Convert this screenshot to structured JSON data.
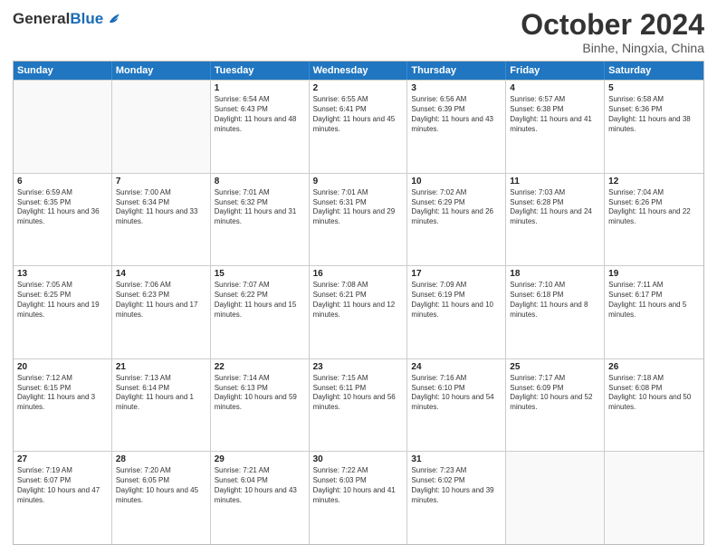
{
  "header": {
    "logo_general": "General",
    "logo_blue": "Blue",
    "month_title": "October 2024",
    "subtitle": "Binhe, Ningxia, China"
  },
  "days_of_week": [
    "Sunday",
    "Monday",
    "Tuesday",
    "Wednesday",
    "Thursday",
    "Friday",
    "Saturday"
  ],
  "weeks": [
    [
      {
        "day": "",
        "info": ""
      },
      {
        "day": "",
        "info": ""
      },
      {
        "day": "1",
        "info": "Sunrise: 6:54 AM\nSunset: 6:43 PM\nDaylight: 11 hours and 48 minutes."
      },
      {
        "day": "2",
        "info": "Sunrise: 6:55 AM\nSunset: 6:41 PM\nDaylight: 11 hours and 45 minutes."
      },
      {
        "day": "3",
        "info": "Sunrise: 6:56 AM\nSunset: 6:39 PM\nDaylight: 11 hours and 43 minutes."
      },
      {
        "day": "4",
        "info": "Sunrise: 6:57 AM\nSunset: 6:38 PM\nDaylight: 11 hours and 41 minutes."
      },
      {
        "day": "5",
        "info": "Sunrise: 6:58 AM\nSunset: 6:36 PM\nDaylight: 11 hours and 38 minutes."
      }
    ],
    [
      {
        "day": "6",
        "info": "Sunrise: 6:59 AM\nSunset: 6:35 PM\nDaylight: 11 hours and 36 minutes."
      },
      {
        "day": "7",
        "info": "Sunrise: 7:00 AM\nSunset: 6:34 PM\nDaylight: 11 hours and 33 minutes."
      },
      {
        "day": "8",
        "info": "Sunrise: 7:01 AM\nSunset: 6:32 PM\nDaylight: 11 hours and 31 minutes."
      },
      {
        "day": "9",
        "info": "Sunrise: 7:01 AM\nSunset: 6:31 PM\nDaylight: 11 hours and 29 minutes."
      },
      {
        "day": "10",
        "info": "Sunrise: 7:02 AM\nSunset: 6:29 PM\nDaylight: 11 hours and 26 minutes."
      },
      {
        "day": "11",
        "info": "Sunrise: 7:03 AM\nSunset: 6:28 PM\nDaylight: 11 hours and 24 minutes."
      },
      {
        "day": "12",
        "info": "Sunrise: 7:04 AM\nSunset: 6:26 PM\nDaylight: 11 hours and 22 minutes."
      }
    ],
    [
      {
        "day": "13",
        "info": "Sunrise: 7:05 AM\nSunset: 6:25 PM\nDaylight: 11 hours and 19 minutes."
      },
      {
        "day": "14",
        "info": "Sunrise: 7:06 AM\nSunset: 6:23 PM\nDaylight: 11 hours and 17 minutes."
      },
      {
        "day": "15",
        "info": "Sunrise: 7:07 AM\nSunset: 6:22 PM\nDaylight: 11 hours and 15 minutes."
      },
      {
        "day": "16",
        "info": "Sunrise: 7:08 AM\nSunset: 6:21 PM\nDaylight: 11 hours and 12 minutes."
      },
      {
        "day": "17",
        "info": "Sunrise: 7:09 AM\nSunset: 6:19 PM\nDaylight: 11 hours and 10 minutes."
      },
      {
        "day": "18",
        "info": "Sunrise: 7:10 AM\nSunset: 6:18 PM\nDaylight: 11 hours and 8 minutes."
      },
      {
        "day": "19",
        "info": "Sunrise: 7:11 AM\nSunset: 6:17 PM\nDaylight: 11 hours and 5 minutes."
      }
    ],
    [
      {
        "day": "20",
        "info": "Sunrise: 7:12 AM\nSunset: 6:15 PM\nDaylight: 11 hours and 3 minutes."
      },
      {
        "day": "21",
        "info": "Sunrise: 7:13 AM\nSunset: 6:14 PM\nDaylight: 11 hours and 1 minute."
      },
      {
        "day": "22",
        "info": "Sunrise: 7:14 AM\nSunset: 6:13 PM\nDaylight: 10 hours and 59 minutes."
      },
      {
        "day": "23",
        "info": "Sunrise: 7:15 AM\nSunset: 6:11 PM\nDaylight: 10 hours and 56 minutes."
      },
      {
        "day": "24",
        "info": "Sunrise: 7:16 AM\nSunset: 6:10 PM\nDaylight: 10 hours and 54 minutes."
      },
      {
        "day": "25",
        "info": "Sunrise: 7:17 AM\nSunset: 6:09 PM\nDaylight: 10 hours and 52 minutes."
      },
      {
        "day": "26",
        "info": "Sunrise: 7:18 AM\nSunset: 6:08 PM\nDaylight: 10 hours and 50 minutes."
      }
    ],
    [
      {
        "day": "27",
        "info": "Sunrise: 7:19 AM\nSunset: 6:07 PM\nDaylight: 10 hours and 47 minutes."
      },
      {
        "day": "28",
        "info": "Sunrise: 7:20 AM\nSunset: 6:05 PM\nDaylight: 10 hours and 45 minutes."
      },
      {
        "day": "29",
        "info": "Sunrise: 7:21 AM\nSunset: 6:04 PM\nDaylight: 10 hours and 43 minutes."
      },
      {
        "day": "30",
        "info": "Sunrise: 7:22 AM\nSunset: 6:03 PM\nDaylight: 10 hours and 41 minutes."
      },
      {
        "day": "31",
        "info": "Sunrise: 7:23 AM\nSunset: 6:02 PM\nDaylight: 10 hours and 39 minutes."
      },
      {
        "day": "",
        "info": ""
      },
      {
        "day": "",
        "info": ""
      }
    ]
  ]
}
